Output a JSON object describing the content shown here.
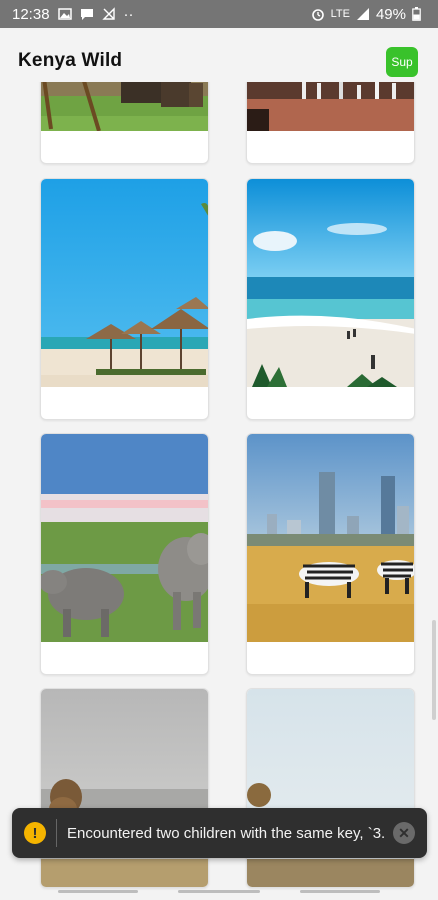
{
  "status_bar": {
    "time": "12:38",
    "dots": "··",
    "battery": "49%",
    "lte": "LTE"
  },
  "header": {
    "title": "Kenya Wild",
    "sup_label": "Sup"
  },
  "cards": [
    {
      "name": "card-1",
      "scene": "savanna-horses"
    },
    {
      "name": "card-2",
      "scene": "flamingo-red-ground"
    },
    {
      "name": "card-3",
      "scene": "beach-umbrellas"
    },
    {
      "name": "card-4",
      "scene": "beach-ocean"
    },
    {
      "name": "card-5",
      "scene": "rhinos-flamingos"
    },
    {
      "name": "card-6",
      "scene": "zebras-city"
    },
    {
      "name": "card-7",
      "scene": "lion-hazy"
    },
    {
      "name": "card-8",
      "scene": "lion-sky"
    }
  ],
  "toast": {
    "message": "Encountered two children with the same key, `3...",
    "warn_symbol": "!",
    "close_symbol": "✕"
  }
}
